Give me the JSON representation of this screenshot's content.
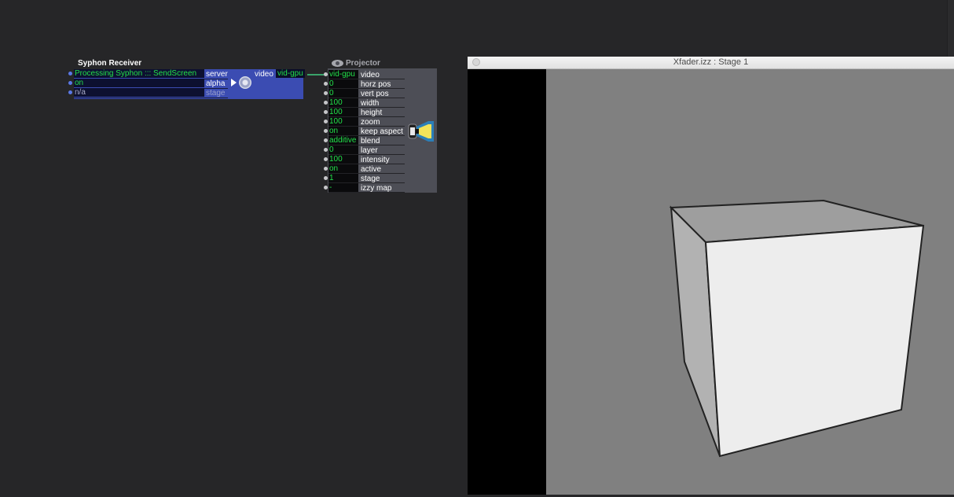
{
  "syphon_receiver": {
    "title": "Syphon Receiver",
    "inputs": [
      {
        "value": "Processing Syphon ::: SendScreen",
        "label": "server"
      },
      {
        "value": "on",
        "label": "alpha"
      },
      {
        "value": "n/a",
        "label": "stage"
      }
    ],
    "output": {
      "label": "video",
      "value": "vid-gpu"
    }
  },
  "projector": {
    "title": "Projector",
    "inputs": [
      {
        "value": "vid-gpu",
        "label": "video"
      },
      {
        "value": "0",
        "label": "horz pos"
      },
      {
        "value": "0",
        "label": "vert pos"
      },
      {
        "value": "100",
        "label": "width"
      },
      {
        "value": "100",
        "label": "height"
      },
      {
        "value": "100",
        "label": "zoom"
      },
      {
        "value": "on",
        "label": "keep aspect"
      },
      {
        "value": "additive",
        "label": "blend"
      },
      {
        "value": "0",
        "label": "layer"
      },
      {
        "value": "100",
        "label": "intensity"
      },
      {
        "value": "on",
        "label": "active"
      },
      {
        "value": "1",
        "label": "stage"
      },
      {
        "value": "-",
        "label": "izzy map"
      }
    ]
  },
  "stage_window": {
    "title": "Xfader.izz : Stage 1"
  },
  "colors": {
    "editor_bg": "#262628",
    "syphon_actor": "#3b4cb2",
    "projector_actor": "#4d4e56",
    "value_text": "#22e04a",
    "stage_gray": "#808080"
  }
}
